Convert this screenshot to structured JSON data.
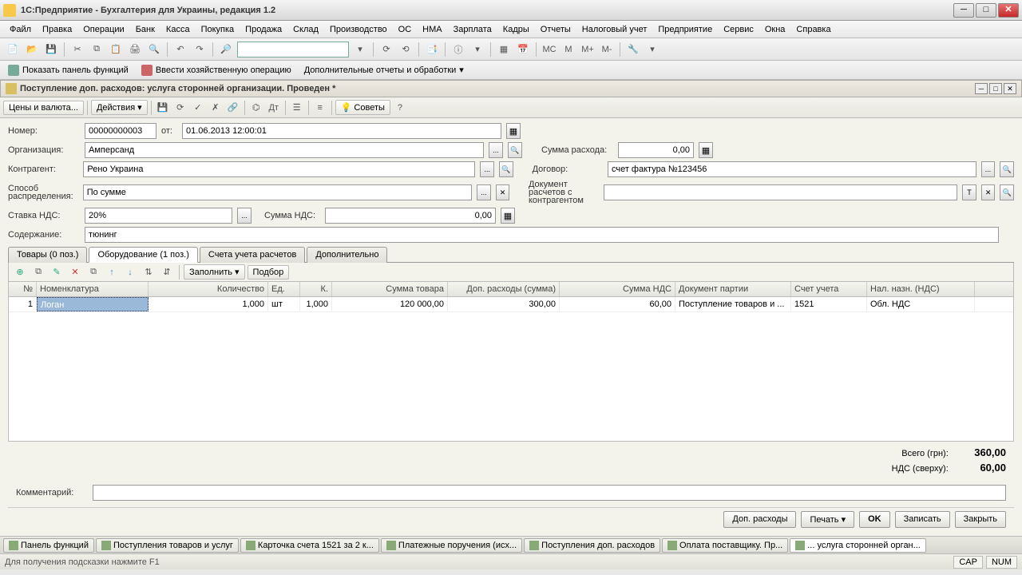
{
  "window_title": "1С:Предприятие - Бухгалтерия для Украины, редакция 1.2",
  "menu": [
    "Файл",
    "Правка",
    "Операции",
    "Банк",
    "Касса",
    "Покупка",
    "Продажа",
    "Склад",
    "Производство",
    "ОС",
    "НМА",
    "Зарплата",
    "Кадры",
    "Отчеты",
    "Налоговый учет",
    "Предприятие",
    "Сервис",
    "Окна",
    "Справка"
  ],
  "funcbar": {
    "show_panel": "Показать панель функций",
    "enter_op": "Ввести хозяйственную операцию",
    "reports": "Дополнительные отчеты и обработки"
  },
  "doc_title": "Поступление доп. расходов: услуга сторонней организации. Проведен *",
  "doc_toolbar": {
    "prices": "Цены и валюта...",
    "actions": "Действия",
    "advices": "Советы"
  },
  "form": {
    "number_label": "Номер:",
    "number": "00000000003",
    "from_label": "от:",
    "date": "01.06.2013 12:00:01",
    "org_label": "Организация:",
    "org": "Амперсанд",
    "sum_label": "Сумма расхода:",
    "sum": "0,00",
    "contr_label": "Контрагент:",
    "contr": "Рено Украина",
    "dogovor_label": "Договор:",
    "dogovor": "счет фактура №123456",
    "sposob_label": "Способ распределения:",
    "sposob": "По сумме",
    "docrasch_label": "Документ расчетов с контрагентом",
    "docrasch": "",
    "stavka_label": "Ставка НДС:",
    "stavka": "20%",
    "sumnds_label": "Сумма НДС:",
    "sumnds": "0,00",
    "soderz_label": "Содержание:",
    "soderz": "тюнинг"
  },
  "tabs": [
    "Товары (0 поз.)",
    "Оборудование (1 поз.)",
    "Счета учета расчетов",
    "Дополнительно"
  ],
  "tab_tools": {
    "fill": "Заполнить",
    "pick": "Подбор"
  },
  "grid": {
    "headers": [
      "№",
      "Номенклатура",
      "Количество",
      "Ед.",
      "К.",
      "Сумма товара",
      "Доп. расходы (сумма)",
      "Сумма НДС",
      "Документ партии",
      "Счет учета",
      "Нал. назн. (НДС)"
    ],
    "row": {
      "n": "1",
      "nom": "Логан",
      "qty": "1,000",
      "ed": "шт",
      "k": "1,000",
      "sum": "120 000,00",
      "dop": "300,00",
      "nds": "60,00",
      "doc": "Поступление товаров и ...",
      "sch": "1521",
      "nal": "Обл. НДС"
    }
  },
  "totals": {
    "total_label": "Всего (грн):",
    "total": "360,00",
    "nds_label": "НДС (сверху):",
    "nds": "60,00"
  },
  "comment_label": "Комментарий:",
  "comment": "",
  "actions": {
    "dop": "Доп. расходы",
    "print": "Печать",
    "ok": "OK",
    "write": "Записать",
    "close": "Закрыть"
  },
  "window_tabs": [
    "Панель функций",
    "Поступления товаров и услуг",
    "Карточка счета 1521 за 2 к...",
    "Платежные поручения (исх...",
    "Поступления доп. расходов",
    "Оплата поставщику. Пр...",
    "... услуга сторонней орган..."
  ],
  "status": {
    "msg": "Для получения подсказки нажмите F1",
    "cap": "CAP",
    "num": "NUM"
  }
}
